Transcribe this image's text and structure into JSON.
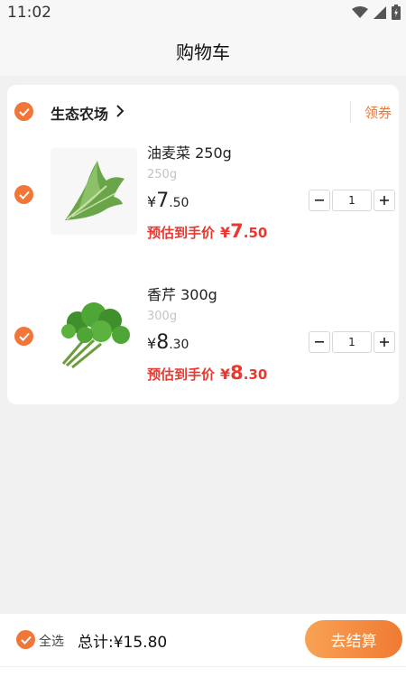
{
  "status_bar": {
    "time": "11:02"
  },
  "header": {
    "title": "购物车"
  },
  "shop": {
    "name": "生态农场",
    "coupon": "领券"
  },
  "items": [
    {
      "name": "油麦菜 250g",
      "spec": "250g",
      "price_yen": "¥",
      "price_int": "7",
      "price_dec": ".50",
      "est_label": "预估到手价",
      "est_yen": "¥",
      "est_int": "7",
      "est_dec": ".50",
      "quantity": "1"
    },
    {
      "name": "香芹 300g",
      "spec": "300g",
      "price_yen": "¥",
      "price_int": "8",
      "price_dec": ".30",
      "est_label": "预估到手价",
      "est_yen": "¥",
      "est_int": "8",
      "est_dec": ".30",
      "quantity": "1"
    }
  ],
  "footer": {
    "select_all": "全选",
    "total_label": "总计:",
    "total_value": "¥15.80",
    "checkout": "去结算"
  },
  "colors": {
    "accent": "#f0763a",
    "price_red": "#e8382f"
  }
}
